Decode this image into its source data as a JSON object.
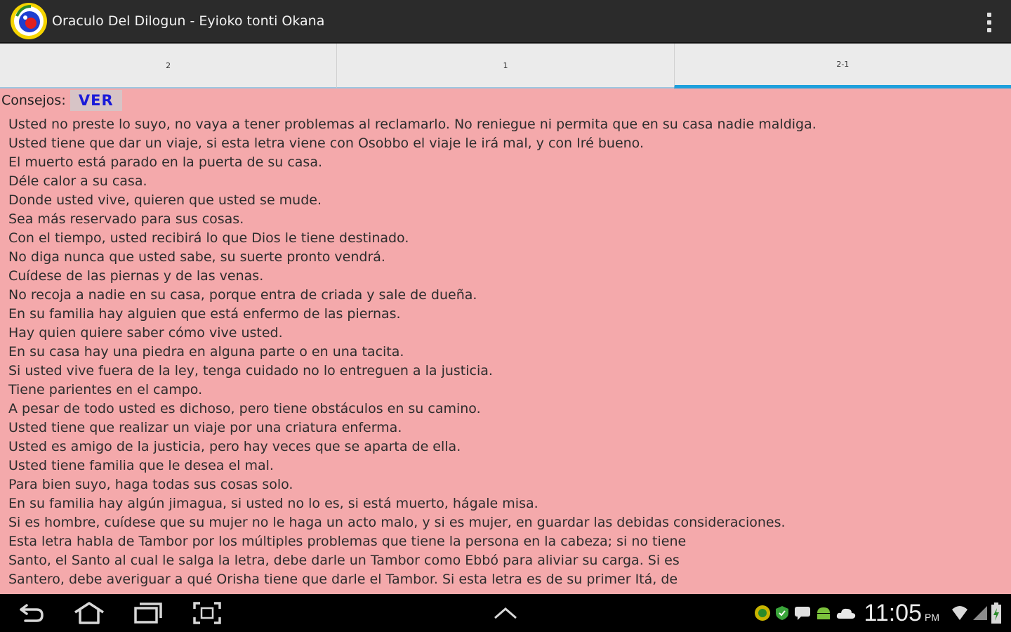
{
  "app": {
    "title": "Oraculo Del Dilogun - Eyioko tonti Okana"
  },
  "tabs": [
    {
      "label": "2",
      "active": false
    },
    {
      "label": "1",
      "active": false
    },
    {
      "label": "2-1",
      "active": true
    }
  ],
  "content": {
    "consejos_label": "Consejos:",
    "ver_label": "VER",
    "lines": [
      "Usted no preste lo suyo, no vaya a tener problemas al reclamarlo. No reniegue ni permita que en su casa nadie maldiga.",
      "Usted tiene que dar un viaje, si esta letra viene con Osobbo el viaje le irá mal, y con Iré bueno.",
      "El muerto está parado en la puerta de su casa.",
      "Déle calor a su casa.",
      "Donde usted vive, quieren que usted se mude.",
      "Sea más reservado para sus cosas.",
      "Con el tiempo, usted recibirá lo que Dios le tiene destinado.",
      "No diga nunca que usted sabe, su suerte pronto vendrá.",
      "Cuídese de las piernas y de las venas.",
      "No recoja a nadie en su casa, porque entra de criada y sale de dueña.",
      "En su familia hay alguien que está enfermo de las piernas.",
      "Hay quien quiere saber cómo vive usted.",
      "En su casa hay una piedra en alguna parte o en una tacita.",
      "Si usted vive fuera de la ley, tenga cuidado no lo entreguen a la justicia.",
      "Tiene parientes en el campo.",
      "A pesar de todo usted es dichoso, pero tiene obstáculos en su camino.",
      "Usted tiene que realizar un viaje por una criatura enferma.",
      "Usted es amigo de la justicia, pero hay veces que se aparta de ella.",
      "Usted tiene familia que le desea el mal.",
      "Para bien suyo, haga todas sus cosas solo.",
      "En su familia hay algún jimagua, si usted no lo es, si está muerto, hágale misa.",
      "Si es hombre, cuídese que su mujer no le haga un acto malo, y si es mujer, en guardar las debidas consideraciones.",
      "Esta letra habla de Tambor por los múltiples problemas que tiene la persona en la cabeza; si no tiene",
      "Santo, el Santo al cual le salga la letra, debe darle un Tambor como Ebbó para aliviar su carga. Si es",
      "Santero, debe averiguar a qué Orisha tiene que darle el Tambor. Si esta letra es de su primer Itá, de"
    ]
  },
  "status_bar": {
    "time": "11:05",
    "ampm": "PM"
  },
  "icons": {
    "app": "dilogun-app-icon",
    "overflow": "overflow-menu-icon",
    "back": "back-icon",
    "home": "home-icon",
    "recents": "recent-apps-icon",
    "screenshot": "screenshot-icon",
    "up": "chevron-up-icon"
  },
  "colors": {
    "background": "#f4a9ab",
    "action_bar": "#2b2b2b",
    "tab_indicator": "#1ea0dc",
    "ver_text": "#1a1ad8"
  }
}
